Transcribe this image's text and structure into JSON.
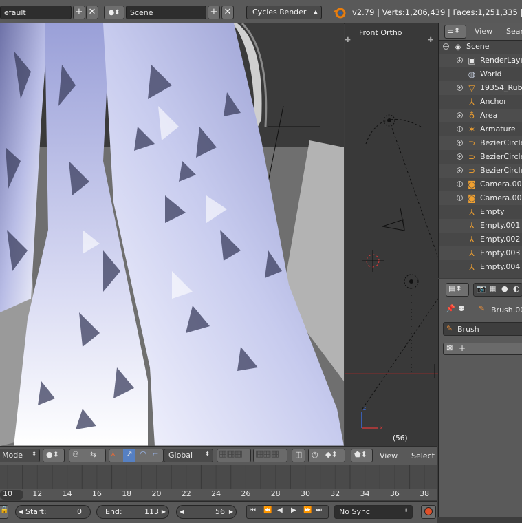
{
  "top_bar": {
    "screen_layout": "efault",
    "scene_name": "Scene",
    "render_engine": "Cycles Render",
    "stats": "v2.79 | Verts:1,206,439 | Faces:1,251,335 | Tris"
  },
  "ortho_viewport": {
    "title": "Front Ortho",
    "frame": "(56)"
  },
  "outliner": {
    "view_label": "View",
    "search_label": "Searc",
    "items": [
      {
        "label": "Scene",
        "icon": "scene-icon"
      },
      {
        "label": "RenderLaye",
        "icon": "render-layers-icon"
      },
      {
        "label": "World",
        "icon": "world-icon"
      },
      {
        "label": "19354_Rub",
        "icon": "mesh-object-icon"
      },
      {
        "label": "Anchor",
        "icon": "empty-object-icon"
      },
      {
        "label": "Area",
        "icon": "lamp-icon"
      },
      {
        "label": "Armature",
        "icon": "armature-icon"
      },
      {
        "label": "BezierCircle",
        "icon": "curve-icon"
      },
      {
        "label": "BezierCircle",
        "icon": "curve-icon"
      },
      {
        "label": "BezierCircle",
        "icon": "curve-icon"
      },
      {
        "label": "Camera.001",
        "icon": "camera-icon"
      },
      {
        "label": "Camera.002",
        "icon": "camera-icon"
      },
      {
        "label": "Empty",
        "icon": "empty-object-icon"
      },
      {
        "label": "Empty.001",
        "icon": "empty-object-icon"
      },
      {
        "label": "Empty.002",
        "icon": "empty-object-icon"
      },
      {
        "label": "Empty.003",
        "icon": "empty-object-icon"
      },
      {
        "label": "Empty.004",
        "icon": "empty-object-icon"
      }
    ]
  },
  "properties": {
    "brush_datablock": "Brush.00",
    "brush_panel": "Brush"
  },
  "view3d_header": {
    "mode": "Mode",
    "orientation": "Global",
    "view_label": "View",
    "select_label": "Select"
  },
  "timeline": {
    "ticks": [
      "10",
      "12",
      "14",
      "16",
      "18",
      "20",
      "22",
      "24",
      "26",
      "28",
      "30",
      "32",
      "34",
      "36",
      "38"
    ],
    "start_label": "Start:",
    "start_value": "0",
    "end_label": "End:",
    "end_value": "113",
    "current_frame": "56",
    "sync_mode": "No Sync"
  },
  "colors": {
    "accent_blue": "#5680c2",
    "header_grey": "#595959",
    "mesh_tint": "#aab0e0"
  }
}
